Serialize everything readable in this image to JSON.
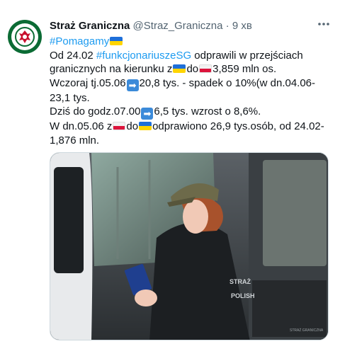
{
  "author": {
    "name": "Straż Graniczna",
    "handle": "@Straz_Graniczna",
    "separator": "·",
    "time": "9 хв"
  },
  "tweet": {
    "hashtag_line": "#Pomagamy",
    "l1_a": "Od 24.02 ",
    "l1_tag": "#funkcjonariuszeSG",
    "l1_b": " odprawili w przejściach granicznych na kierunku z",
    "l1_c": "do",
    "l1_d": "3,859 mln os.",
    "l2_a": "Wczoraj tj.05.06",
    "l2_b": "20,8 tys. - spadek o 10%(w dn.04.06-23,1 tys.",
    "l3_a": "Dziś do godz.07.00",
    "l3_b": "6,5 tys. wzrost o 8,6%.",
    "l4_a": "W dn.05.06 z",
    "l4_b": "do",
    "l4_c": "odprawiono 26,9 tys.osób, od 24.02-1,876 mln.",
    "arrow_glyph": "➡"
  },
  "media": {
    "vest_text_1": "STRAŻ",
    "vest_text_2": "POLISH",
    "watermark": "STRAŻ GRANICZNA"
  },
  "colors": {
    "link": "#1d9bf0",
    "brand_green": "#0b6b34"
  },
  "icons": {
    "more": "more-options-icon",
    "flag_ua": "ukraine-flag-icon",
    "flag_pl": "poland-flag-icon",
    "arrow": "right-arrow-icon"
  }
}
